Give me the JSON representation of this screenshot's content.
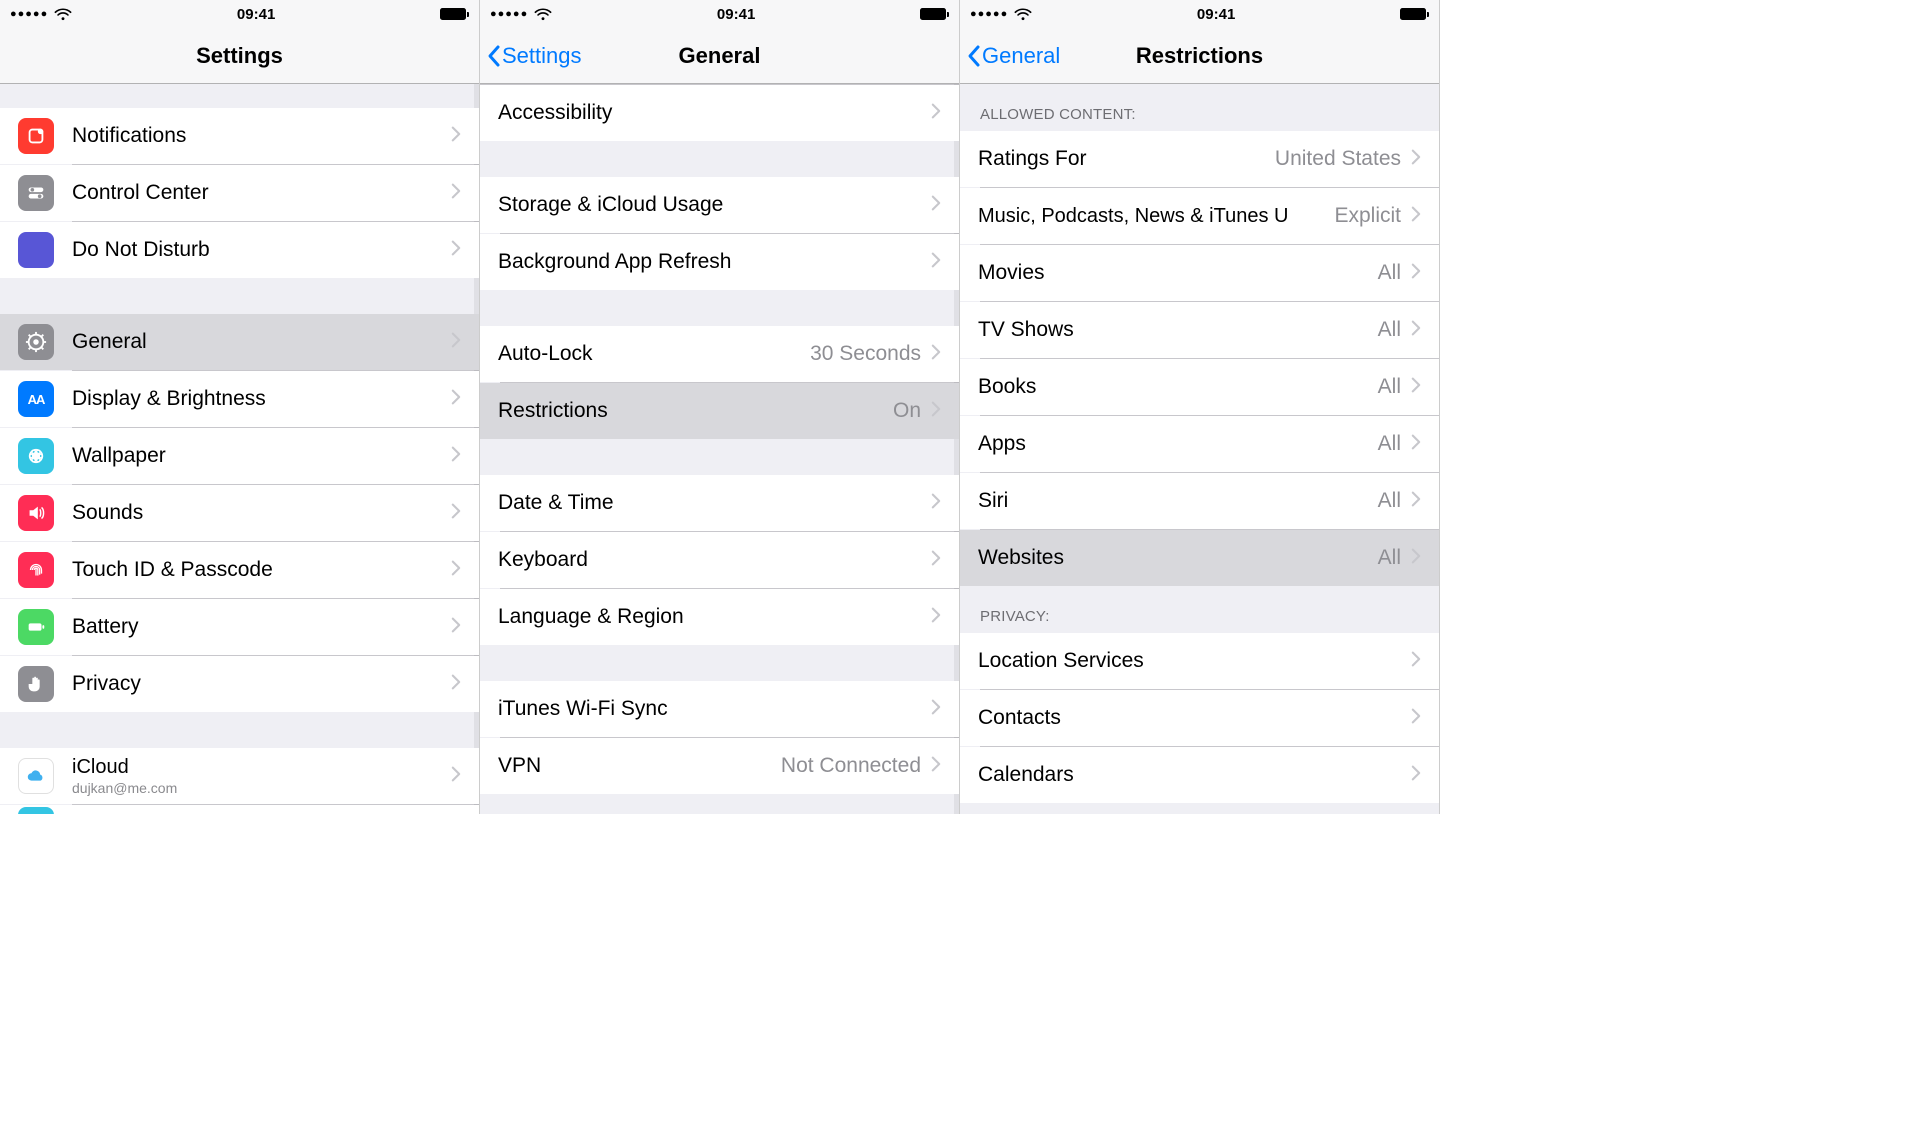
{
  "status": {
    "time": "09:41"
  },
  "screen1": {
    "title": "Settings",
    "rows": {
      "notifications": "Notifications",
      "control_center": "Control Center",
      "dnd": "Do Not Disturb",
      "general": "General",
      "display": "Display & Brightness",
      "wallpaper": "Wallpaper",
      "sounds": "Sounds",
      "touchid": "Touch ID & Passcode",
      "battery": "Battery",
      "privacy": "Privacy",
      "icloud": "iCloud",
      "icloud_sub": "dujkan@me.com"
    }
  },
  "screen2": {
    "back": "Settings",
    "title": "General",
    "rows": {
      "accessibility": "Accessibility",
      "storage": "Storage & iCloud Usage",
      "background": "Background App Refresh",
      "autolock": "Auto-Lock",
      "autolock_val": "30 Seconds",
      "restrictions": "Restrictions",
      "restrictions_val": "On",
      "datetime": "Date & Time",
      "keyboard": "Keyboard",
      "language": "Language & Region",
      "itunes": "iTunes Wi-Fi Sync",
      "vpn": "VPN",
      "vpn_val": "Not Connected"
    }
  },
  "screen3": {
    "back": "General",
    "title": "Restrictions",
    "headers": {
      "allowed": "ALLOWED CONTENT:",
      "privacy": "PRIVACY:"
    },
    "rows": {
      "ratings": "Ratings For",
      "ratings_val": "United States",
      "music": "Music, Podcasts, News & iTunes U",
      "music_val": "Explicit",
      "movies": "Movies",
      "movies_val": "All",
      "tv": "TV Shows",
      "tv_val": "All",
      "books": "Books",
      "books_val": "All",
      "apps": "Apps",
      "apps_val": "All",
      "siri": "Siri",
      "siri_val": "All",
      "websites": "Websites",
      "websites_val": "All",
      "location": "Location Services",
      "contacts": "Contacts",
      "calendars": "Calendars"
    }
  }
}
